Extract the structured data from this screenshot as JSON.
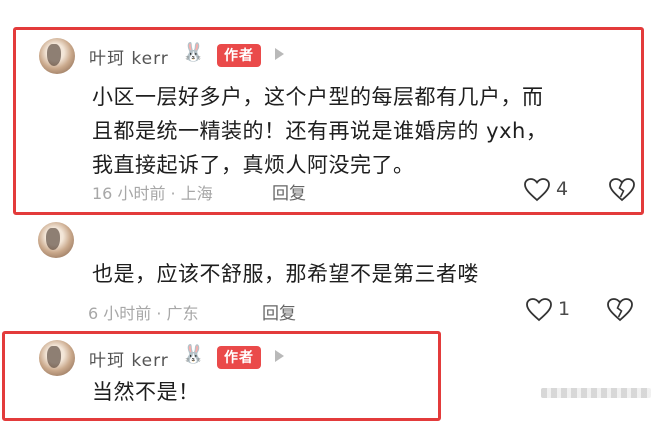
{
  "comments": [
    {
      "author": "叶珂 kerr",
      "emoji": "🐰",
      "badge": "作者",
      "text_lines": [
        "小区一层好多户，这个户型的每层都有几户，而",
        "且都是统一精装的！还有再说是谁婚房的 yxh，",
        "我直接起诉了，真烦人阿没完了。"
      ],
      "time_location": "16 小时前 · 上海",
      "reply_label": "回复",
      "likes": "4"
    },
    {
      "text_lines": [
        "也是，应该不舒服，那希望不是第三者喽"
      ],
      "time_location": "6 小时前 · 广东",
      "reply_label": "回复",
      "likes": "1"
    },
    {
      "author": "叶珂 kerr",
      "emoji": "🐰",
      "badge": "作者",
      "text_lines": [
        "当然不是！"
      ]
    }
  ],
  "colors": {
    "highlight_frame": "#e33b3b",
    "author_badge": "#ea4a4a"
  },
  "icons": [
    "like-heart-icon",
    "dislike-broken-heart-icon",
    "play-triangle-icon",
    "rabbit-emoji-icon"
  ]
}
